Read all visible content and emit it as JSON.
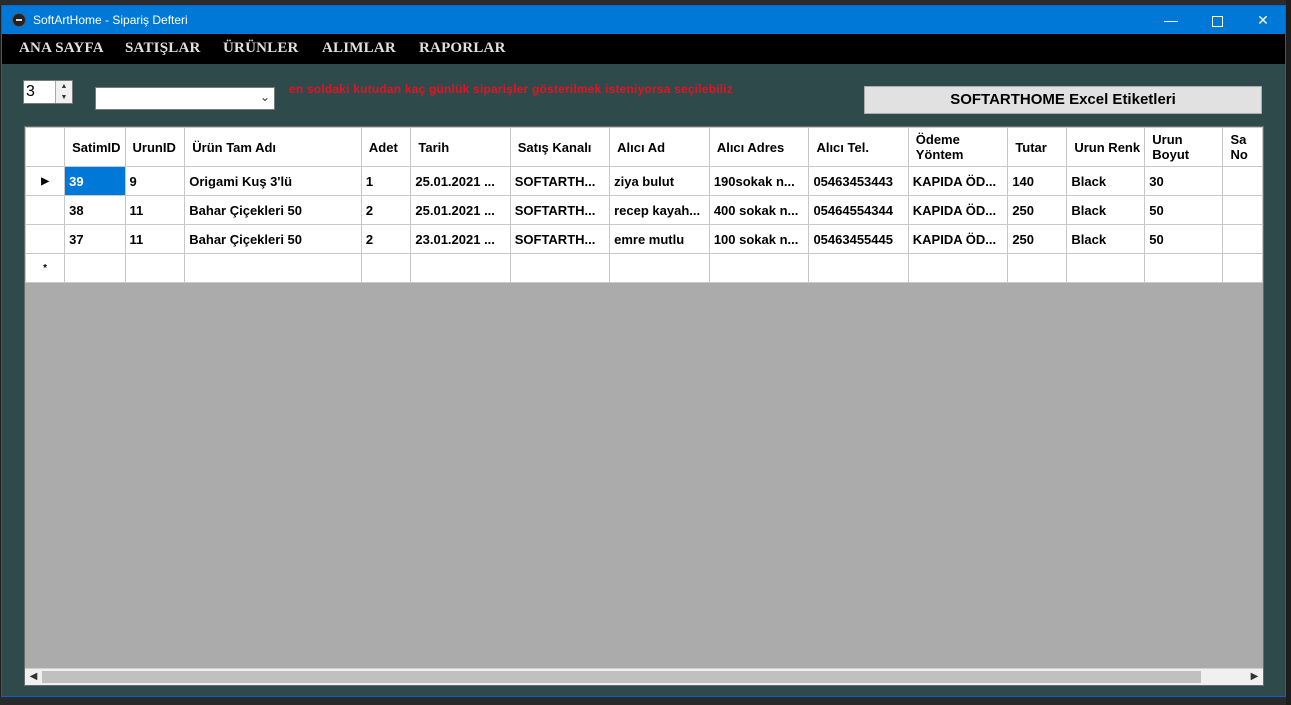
{
  "window": {
    "title": "SoftArtHome - Sipariş Defteri",
    "minimize": "—",
    "close": "✕"
  },
  "menu": [
    "ANA SAYFA",
    "SATIŞLAR",
    "ÜRÜNLER",
    "ALIMLAR",
    "RAPORLAR"
  ],
  "controls": {
    "days_value": "3",
    "dropdown_value": "",
    "hint": "en soldaki kutudan kaç günlük siparişler gösterilmek isteniyorsa seçilebiliz",
    "excel_button": "SOFTARTHOME Excel Etiketleri"
  },
  "grid": {
    "columns": [
      "SatimID",
      "UrunID",
      "Ürün Tam Adı",
      "Adet",
      "Tarih",
      "Satış Kanalı",
      "Alıcı Ad",
      "Alıcı Adres",
      "Alıcı Tel.",
      "Ödeme Yöntem",
      "Tutar",
      "Urun Renk",
      "Urun Boyut",
      "Sa No"
    ],
    "rows": [
      [
        "39",
        "9",
        "Origami Kuş 3'lü",
        "1",
        "25.01.2021 ...",
        "SOFTARTH...",
        "ziya bulut",
        "190sokak n...",
        "05463453443",
        "KAPIDA ÖD...",
        "140",
        "Black",
        "30",
        ""
      ],
      [
        "38",
        "11",
        "Bahar Çiçekleri 50",
        "2",
        "25.01.2021 ...",
        "SOFTARTH...",
        "recep kayah...",
        "400 sokak n...",
        "05464554344",
        "KAPIDA ÖD...",
        "250",
        "Black",
        "50",
        ""
      ],
      [
        "37",
        "11",
        "Bahar Çiçekleri 50",
        "2",
        "23.01.2021 ...",
        "SOFTARTH...",
        "emre mutlu",
        "100 sokak n...",
        "05463455445",
        "KAPIDA ÖD...",
        "250",
        "Black",
        "50",
        ""
      ]
    ],
    "current_row_marker": "▶",
    "new_row_marker": "*"
  },
  "colors": {
    "titlebar": "#0078d7",
    "selection": "#0078d7",
    "hint": "#e81123"
  },
  "icons": {
    "app": "app-logo-icon",
    "spin_up": "chevron-up-icon",
    "spin_down": "chevron-down-icon",
    "dropdown": "chevron-down-icon"
  }
}
